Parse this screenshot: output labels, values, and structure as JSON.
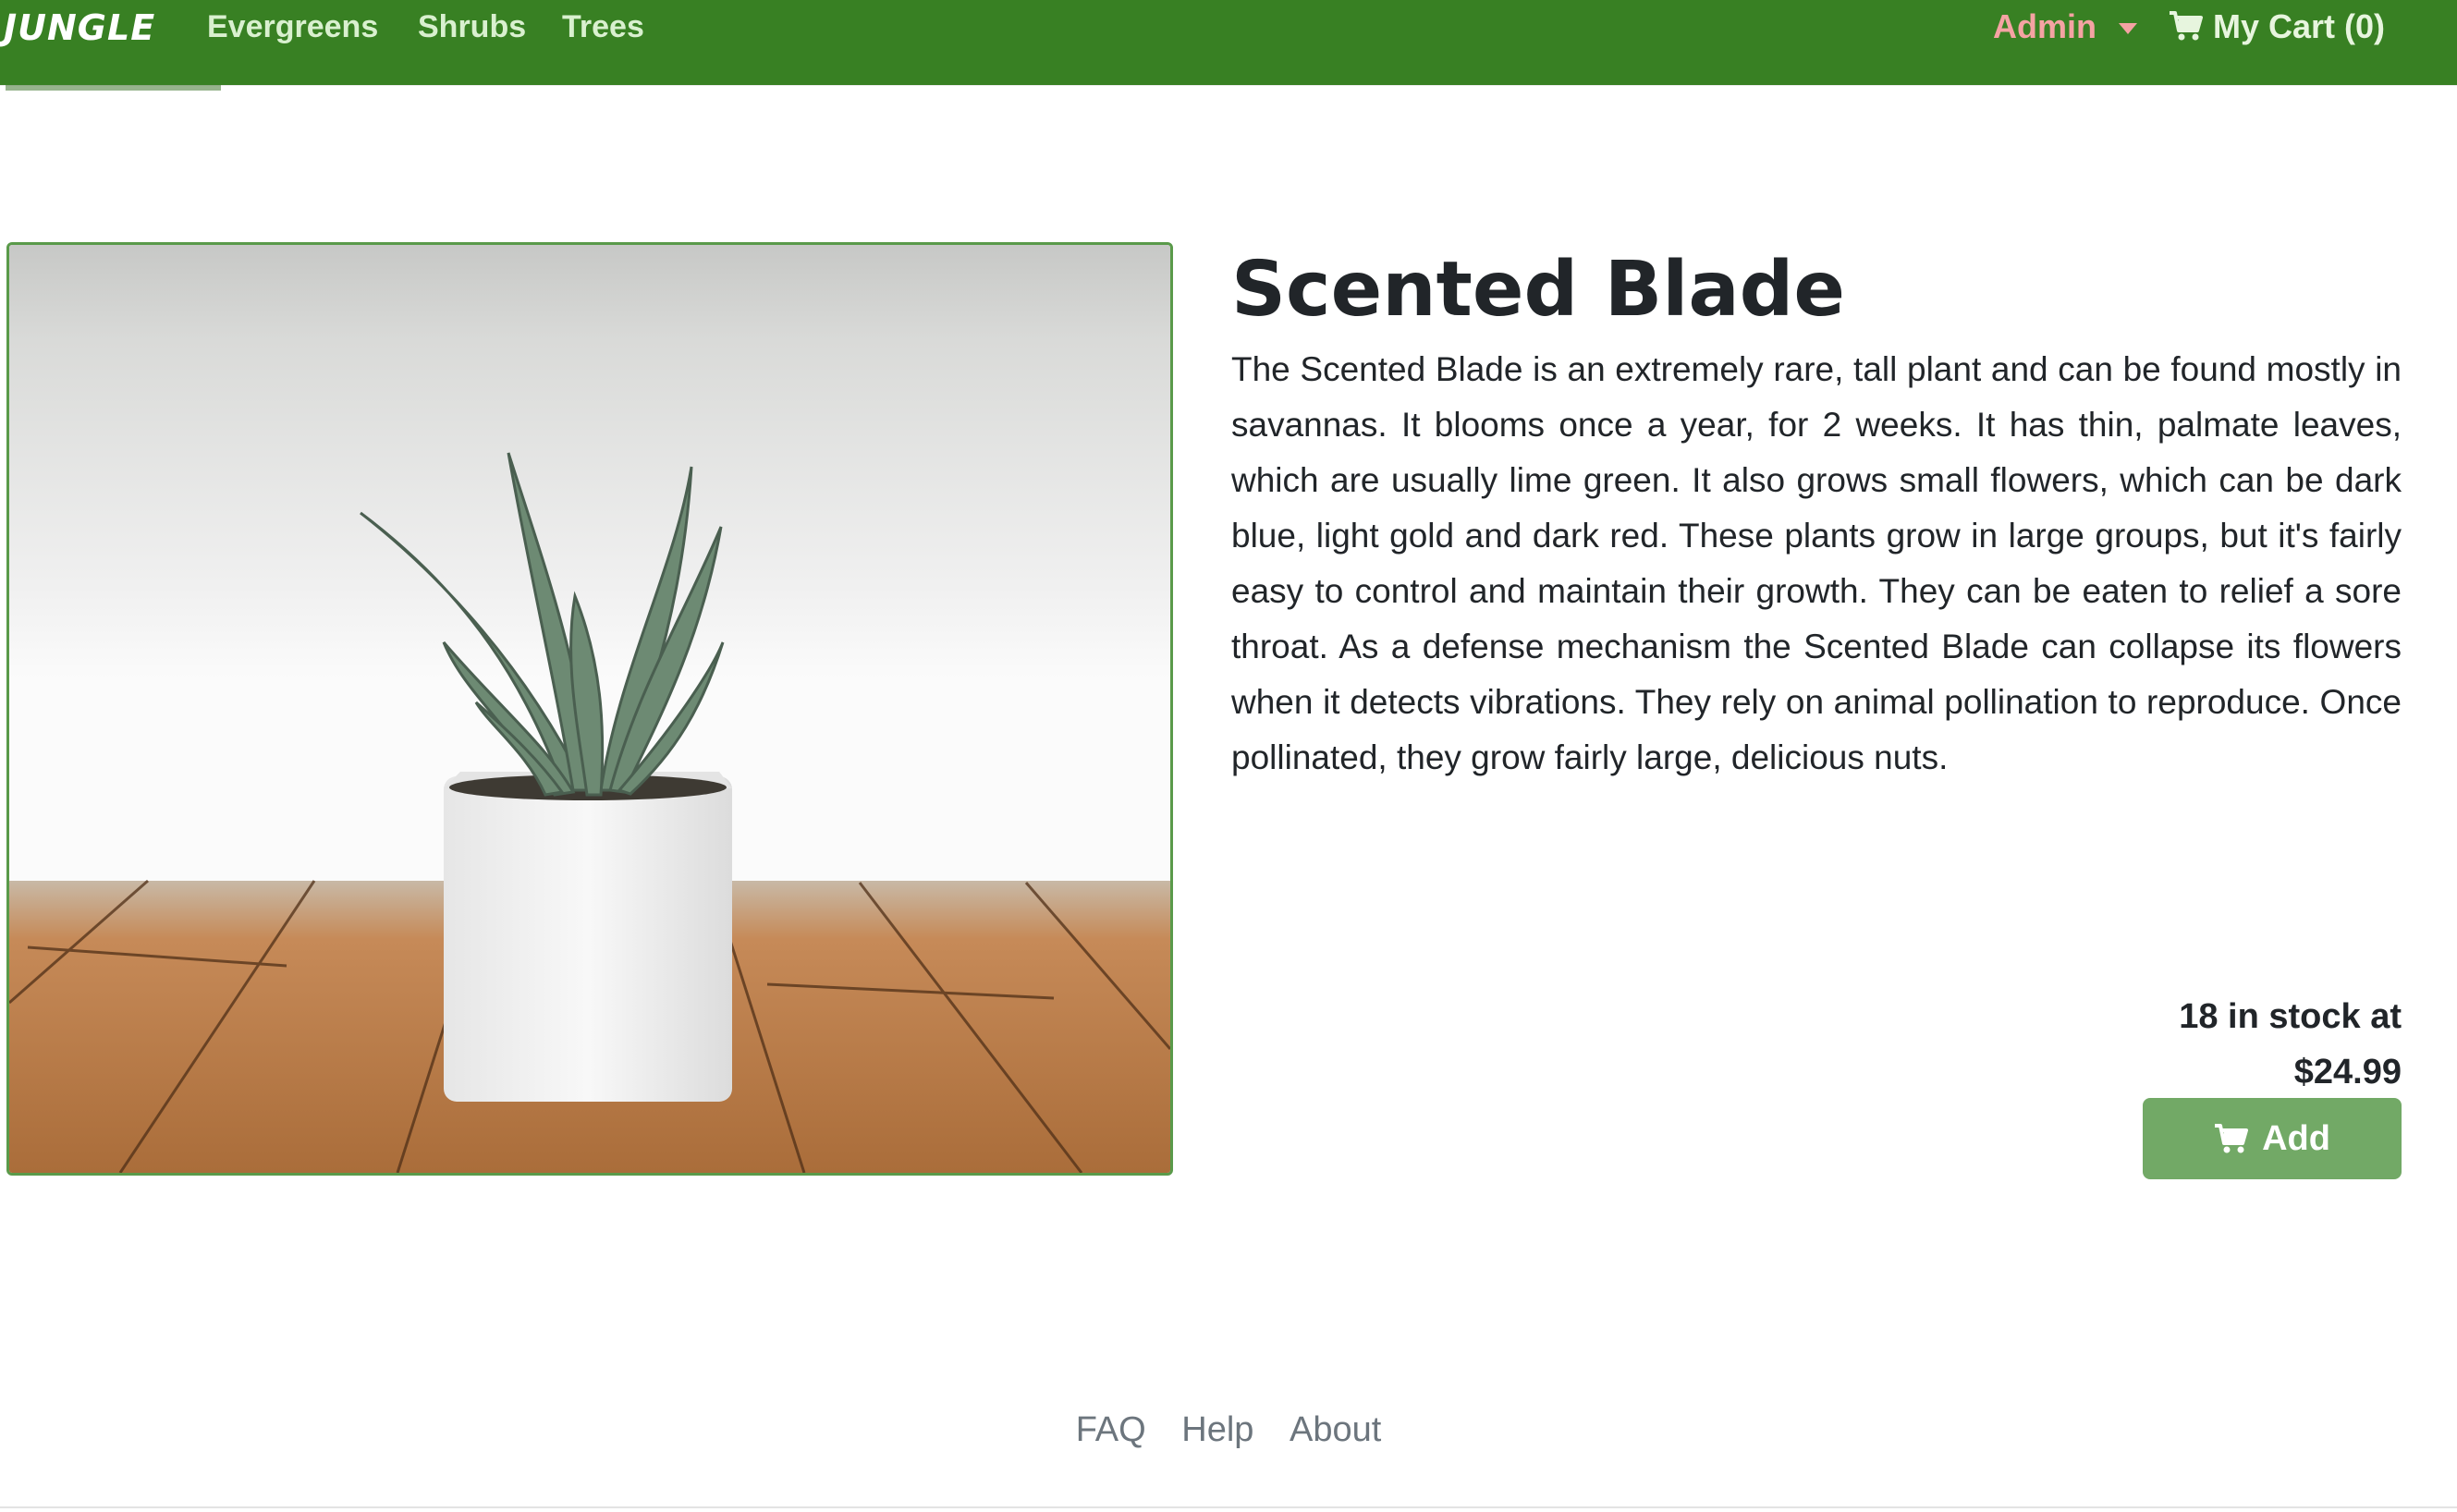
{
  "navbar": {
    "brand": "JUNGLE",
    "links": [
      "Evergreens",
      "Shrubs",
      "Trees"
    ],
    "admin_label": "Admin",
    "cart_label": "My Cart (0)"
  },
  "product": {
    "title": "Scented Blade",
    "description": "The Scented Blade is an extremely rare, tall plant and can be found mostly in savannas. It blooms once a year, for 2 weeks. It has thin, palmate leaves, which are usually lime green. It also grows small flowers, which can be dark blue, light gold and dark red. These plants grow in large groups, but it's fairly easy to control and maintain their growth. They can be eaten to relief a sore throat. As a defense mechanism the Scented Blade can collapse its flowers when it detects vibrations. They rely on animal pollination to reproduce. Once pollinated, they grow fairly large, delicious nuts.",
    "stock_text": "18 in stock at",
    "price": "$24.99",
    "add_label": "Add"
  },
  "footer": {
    "links": [
      "FAQ",
      "Help",
      "About"
    ]
  },
  "colors": {
    "navbar_bg": "#388023",
    "button_bg": "#72a966",
    "admin_text": "#f5a3a3",
    "image_border": "#5a9a4a"
  },
  "icons": {
    "cart": "shopping-cart-icon",
    "caret": "caret-down-icon"
  }
}
